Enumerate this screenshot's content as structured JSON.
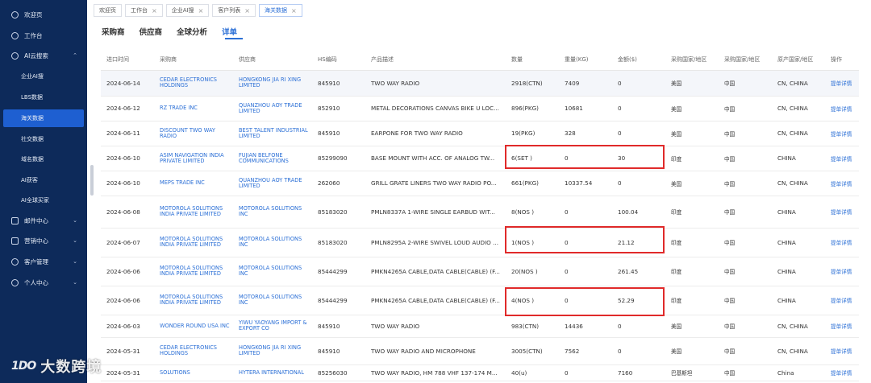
{
  "sidebar": {
    "items": [
      {
        "label": "欢迎页",
        "icon": "home-icon"
      },
      {
        "label": "工作台",
        "icon": "dashboard-icon"
      },
      {
        "label": "AI云搜索",
        "icon": "search-icon"
      },
      {
        "label": "邮件中心",
        "icon": "mail-icon"
      },
      {
        "label": "营销中心",
        "icon": "marketing-icon"
      },
      {
        "label": "客户管理",
        "icon": "customer-icon"
      },
      {
        "label": "个人中心",
        "icon": "user-icon"
      }
    ],
    "subitems": [
      "企业AI搜",
      "LBS数据",
      "海关数据",
      "社交数据",
      "域名数据",
      "AI获客",
      "AI全球买家"
    ],
    "active_sub": "海关数据"
  },
  "tabs": [
    "欢迎页",
    "工作台",
    "企业AI搜",
    "客户列表",
    "海关数据"
  ],
  "subtabs": [
    "采购商",
    "供应商",
    "全球分析",
    "详单"
  ],
  "table": {
    "headers": [
      "进口时间",
      "采购商",
      "供应商",
      "HS编码",
      "产品描述",
      "数量",
      "重量(KG)",
      "金额($)",
      "采购国家/地区",
      "采购国家/地区",
      "原产国家/地区",
      "操作"
    ],
    "rows": [
      [
        "2024-06-14",
        "CEDAR ELECTRONICS HOLDINGS",
        "HONGKONG JIA RI XING LIMITED",
        "845910",
        "TWO WAY RADIO",
        "2918(CTN)",
        "7409",
        "0",
        "美国",
        "中国",
        "CN, CHINA",
        "提单详情"
      ],
      [
        "2024-06-12",
        "RZ TRADE INC",
        "QUANZHOU AOY TRADE LIMITED",
        "852910",
        "METAL DECORATIONS CANVAS BIKE U LOC...",
        "896(PKG)",
        "10681",
        "0",
        "美国",
        "中国",
        "CN, CHINA",
        "提单详情"
      ],
      [
        "2024-06-11",
        "DISCOUNT TWO WAY RADIO",
        "BEST TALENT INDUSTRIAL LIMITED",
        "845910",
        "EARPONE FOR TWO WAY RADIO",
        "19(PKG)",
        "328",
        "0",
        "美国",
        "中国",
        "CN, CHINA",
        "提单详情"
      ],
      [
        "2024-06-10",
        "ASIM NAVIGATION INDIA PRIVATE LIMITED",
        "FUJIAN BELFONE COMMUNICATIONS",
        "85299090",
        "BASE MOUNT WITH ACC. OF ANALOG TW...",
        "6(SET )",
        "0",
        "30",
        "印度",
        "中国",
        "CHINA",
        "提单详情"
      ],
      [
        "2024-06-10",
        "MEPS TRADE INC",
        "QUANZHOU AOY TRADE LIMITED",
        "262060",
        "GRILL GRATE LINERS TWO WAY RADIO PO...",
        "661(PKG)",
        "10337.54",
        "0",
        "美国",
        "中国",
        "CN, CHINA",
        "提单详情"
      ],
      [
        "2024-06-08",
        "MOTOROLA SOLUTIONS INDIA PRIVATE LIMITED",
        "MOTOROLA SOLUTIONS INC",
        "85183020",
        "PMLN8337A 1-WIRE SINGLE EARBUD WIT...",
        "8(NOS )",
        "0",
        "100.04",
        "印度",
        "中国",
        "CHINA",
        "提单详情"
      ],
      [
        "2024-06-07",
        "MOTOROLA SOLUTIONS INDIA PRIVATE LIMITED",
        "MOTOROLA SOLUTIONS INC",
        "85183020",
        "PMLN8295A 2-WIRE SWIVEL LOUD AUDIO ...",
        "1(NOS )",
        "0",
        "21.12",
        "印度",
        "中国",
        "CHINA",
        "提单详情"
      ],
      [
        "2024-06-06",
        "MOTOROLA SOLUTIONS INDIA PRIVATE LIMITED",
        "MOTOROLA SOLUTIONS INC",
        "85444299",
        "PMKN4265A CABLE,DATA CABLE(CABLE) (F...",
        "20(NOS )",
        "0",
        "261.45",
        "印度",
        "中国",
        "CHINA",
        "提单详情"
      ],
      [
        "2024-06-06",
        "MOTOROLA SOLUTIONS INDIA PRIVATE LIMITED",
        "MOTOROLA SOLUTIONS INC",
        "85444299",
        "PMKN4265A CABLE,DATA CABLE(CABLE) (F...",
        "4(NOS )",
        "0",
        "52.29",
        "印度",
        "中国",
        "CHINA",
        "提单详情"
      ],
      [
        "2024-06-03",
        "WONDER ROUND USA INC",
        "YIWU YAOYANG IMPORT & EXPORT CO",
        "845910",
        "TWO WAY RADIO",
        "983(CTN)",
        "14436",
        "0",
        "美国",
        "中国",
        "CN, CHINA",
        "提单详情"
      ],
      [
        "2024-05-31",
        "CEDAR ELECTRONICS HOLDINGS",
        "HONGKONG JIA RI XING LIMITED",
        "845910",
        "TWO WAY RADIO AND MICROPHONE",
        "3005(CTN)",
        "7562",
        "0",
        "美国",
        "中国",
        "CN, CHINA",
        "提单详情"
      ],
      [
        "2024-05-31",
        "SOLUTIONS",
        "HYTERA INTERNATIONAL",
        "85256030",
        "TWO WAY RADIO, HM 788 VHF 137-174 M...",
        "40(u)",
        "0",
        "7160",
        "巴基斯坦",
        "中国",
        "China",
        "提单详情"
      ]
    ]
  },
  "watermark": {
    "logo": "1DO",
    "text": "大数跨境"
  }
}
